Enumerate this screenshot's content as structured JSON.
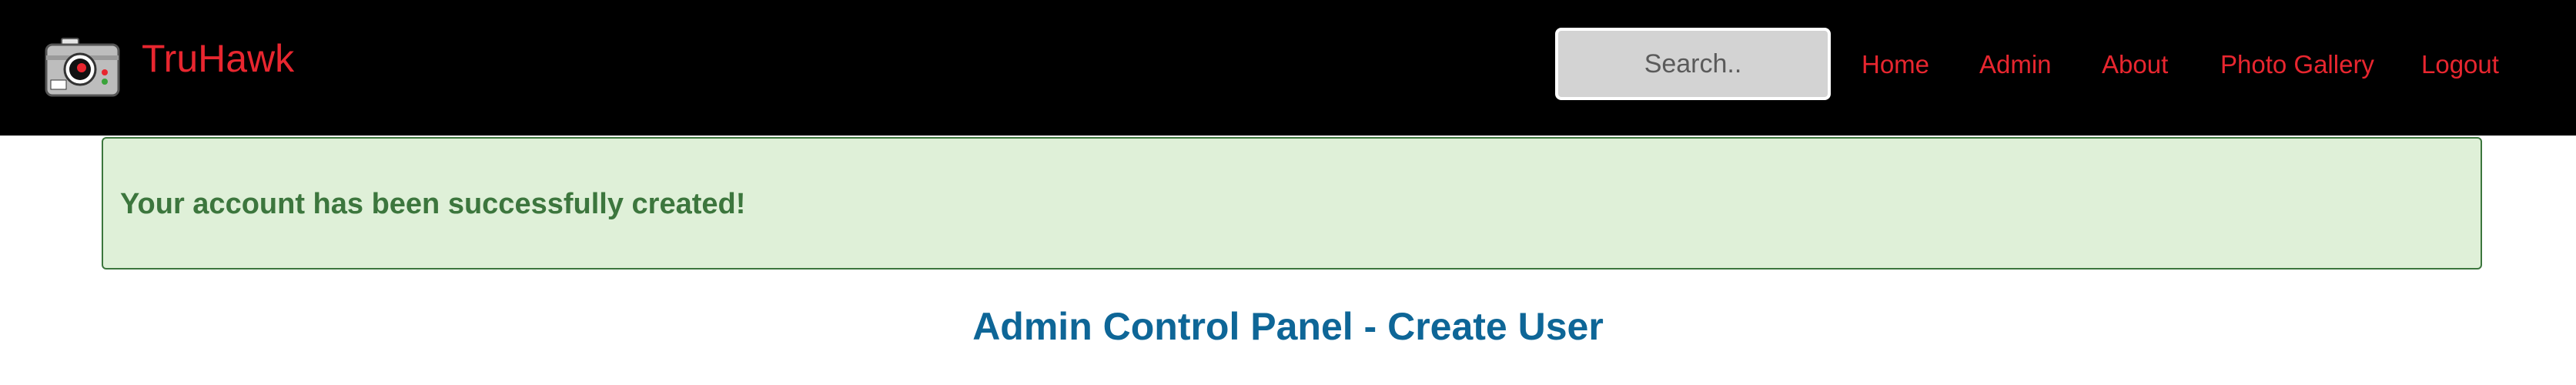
{
  "header": {
    "brand": "TruHawk",
    "search_placeholder": "Search..",
    "nav": [
      "Home",
      "Admin",
      "About",
      "Photo Gallery",
      "Logout"
    ]
  },
  "alert": {
    "message": "Your account has been successfully created!"
  },
  "main": {
    "title": "Admin Control Panel - Create User"
  },
  "colors": {
    "navbar_bg": "#000000",
    "brand_red": "#e8262f",
    "alert_bg": "#dff0d8",
    "alert_text": "#3c763d",
    "title_blue": "#0e6697"
  },
  "icons": {
    "logo": "camera-icon"
  }
}
